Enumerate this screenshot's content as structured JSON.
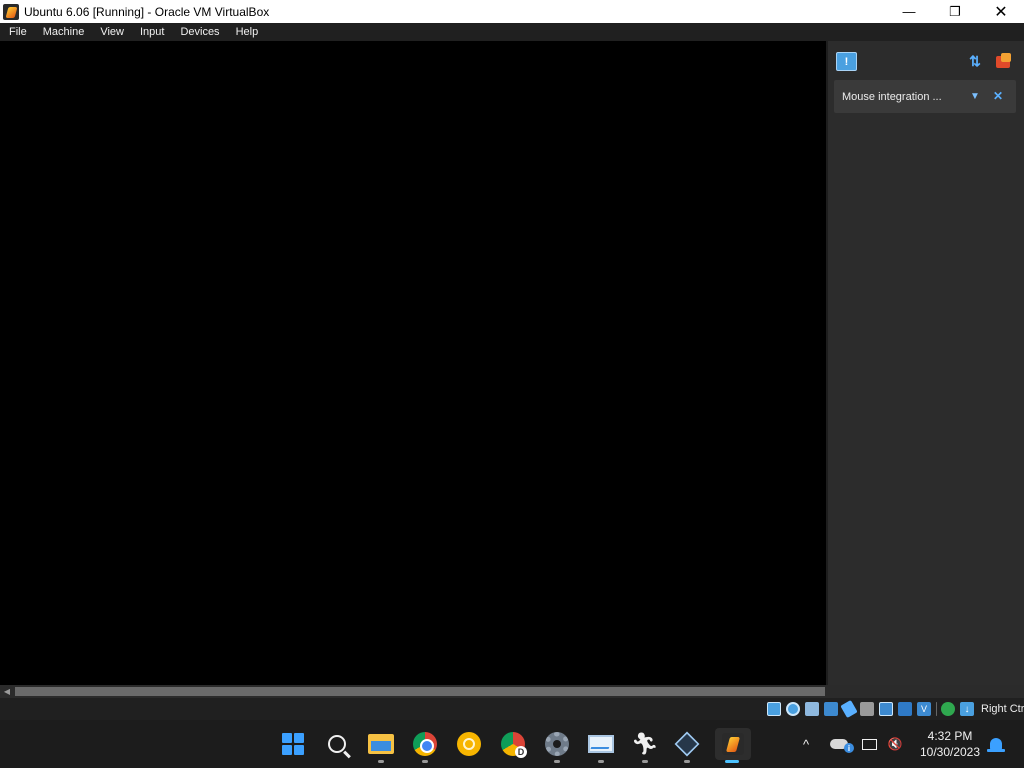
{
  "window": {
    "title": "Ubuntu 6.06 [Running] - Oracle VM VirtualBox",
    "minimize_icon": "minimize-icon",
    "maximize_icon": "restore-icon",
    "close_icon": "close-icon"
  },
  "menu": {
    "items": [
      "File",
      "Machine",
      "View",
      "Input",
      "Devices",
      "Help"
    ]
  },
  "notification_center": {
    "messages": [
      {
        "text": "Mouse integration ...",
        "pin_icon": "pin-icon",
        "close_icon": "close-icon"
      }
    ],
    "toolbar_icons": [
      "message-icon",
      "sort-icon",
      "clear-all-icon"
    ]
  },
  "statusbar": {
    "icons": [
      "hard-disk-icon",
      "optical-drive-icon",
      "audio-icon",
      "network-icon",
      "usb-icon",
      "shared-folders-icon",
      "display-icon",
      "recording-icon",
      "vt-x-icon",
      "mouse-integration-icon",
      "keyboard-capture-icon"
    ],
    "vt_label": "V",
    "host_key": "Right Ctrl"
  },
  "taskbar": {
    "apps": [
      "start-icon",
      "search-icon",
      "file-explorer-icon",
      "chrome-icon",
      "chrome-canary-icon",
      "chrome-dev-icon",
      "settings-icon",
      "system-monitor-icon",
      "runner-icon",
      "virtualbox-manager-icon",
      "virtualbox-vm-icon"
    ],
    "tray": {
      "chevron": "^",
      "volume_symbol": "🔇",
      "time": "4:32 PM",
      "date": "10/30/2023"
    }
  },
  "colors": {
    "accent": "#4cc2ff",
    "vbox_blue": "#4aa0e0",
    "panel_bg": "#2c2c2c",
    "menubar_bg": "#202020"
  }
}
